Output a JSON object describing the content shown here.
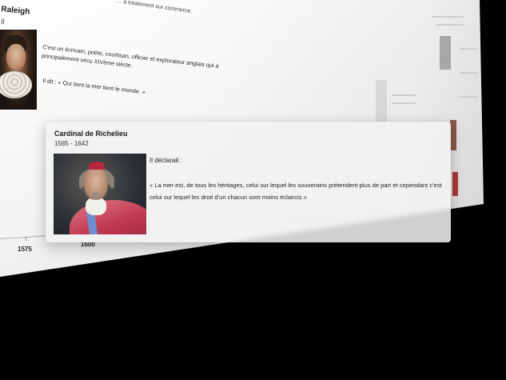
{
  "page": {
    "top_snippet": "… a totalement sur commerce."
  },
  "raleigh": {
    "name": "Raleigh",
    "name_suffix": "ll",
    "description": "C'est un écrivain, poète, courtisan, officier et explorateur anglais qui a principalement vécu XIVème siècle.",
    "quote": "Il dit : «  Qui tient la mer tient le monde. »"
  },
  "timeline": {
    "ticks": [
      "1575",
      "1600"
    ]
  },
  "card": {
    "name": "Cardinal de Richelieu",
    "dates": "1585 - 1642",
    "intro": "Il déclarait :",
    "quote": "«  La mer est, de tous les héritages, celui sur lequel les souverains prétendent plus de part et cependant c'est celui sur lequel les droit d'un chacun sont moins éclaircis »"
  },
  "colors": {
    "background": "#000000",
    "card_background": "#f2f2f2",
    "text": "#222222",
    "cape": "#c03a52"
  },
  "icons": {
    "raleigh_portrait": "portrait-raleigh",
    "richelieu_portrait": "portrait-richelieu"
  }
}
